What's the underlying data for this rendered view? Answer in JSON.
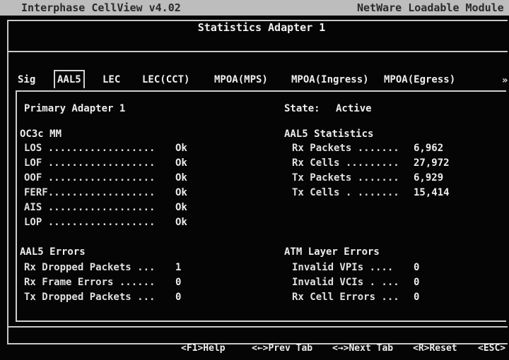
{
  "app": {
    "title": "Interphase CellView  v4.02",
    "module": "NetWare Loadable Module"
  },
  "header": {
    "title": "Statistics Adapter 1"
  },
  "tabs": [
    {
      "label": "Sig"
    },
    {
      "label": "AAL5"
    },
    {
      "label": "LEC"
    },
    {
      "label": "LEC(CCT)"
    },
    {
      "label": "MPOA(MPS)"
    },
    {
      "label": "MPOA(Ingress)"
    },
    {
      "label": "MPOA(Egress)"
    }
  ],
  "tabs_more": "»",
  "active_tab": "AAL5",
  "panel": {
    "adapter": "Primary Adapter 1",
    "state_label": "State:",
    "state_value": "Active",
    "oc3c": {
      "heading": "OC3c MM",
      "rows": [
        {
          "label": "LOS ..................",
          "value": "Ok"
        },
        {
          "label": "LOF ..................",
          "value": "Ok"
        },
        {
          "label": "OOF ..................",
          "value": "Ok"
        },
        {
          "label": "FERF..................",
          "value": "Ok"
        },
        {
          "label": "AIS ..................",
          "value": "Ok"
        },
        {
          "label": "LOP ..................",
          "value": "Ok"
        }
      ]
    },
    "aal5_stats": {
      "heading": "AAL5 Statistics",
      "rows": [
        {
          "label": "Rx Packets .......",
          "value": "6,962"
        },
        {
          "label": "Rx Cells .........",
          "value": "27,972"
        },
        {
          "label": "Tx Packets .......",
          "value": "6,929"
        },
        {
          "label": "Tx Cells . .......",
          "value": "15,414"
        }
      ]
    },
    "aal5_errors": {
      "heading": "AAL5 Errors",
      "rows": [
        {
          "label": "Rx Dropped Packets ...",
          "value": "1"
        },
        {
          "label": "Rx Frame Errors ......",
          "value": "0"
        },
        {
          "label": "Tx Dropped Packets ...",
          "value": "0"
        }
      ]
    },
    "atm_errors": {
      "heading": "ATM Layer Errors",
      "rows": [
        {
          "label": "Invalid VPIs ....",
          "value": "0"
        },
        {
          "label": "Invalid VCIs . ...",
          "value": "0"
        },
        {
          "label": "Rx Cell Errors ...",
          "value": "0"
        }
      ]
    }
  },
  "footer": {
    "help": "<F1>Help",
    "prev": "<←>Prev Tab",
    "next": "<→>Next Tab",
    "reset": "<R>Reset",
    "esc": "<ESC>"
  }
}
